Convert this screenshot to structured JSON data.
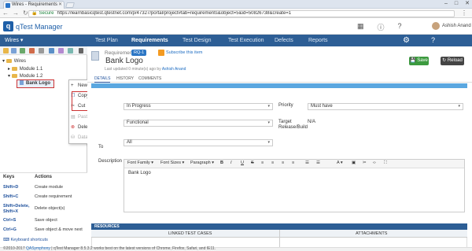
{
  "browser": {
    "tab_title": "Wires - Requirements",
    "url_secure_label": "Secure",
    "url_path": "https://learnbasicqtest.qtestnet.com/p/47327/portal/project#tab=requirements&object=5&id=50826738&create=1"
  },
  "app": {
    "logo_text": "qTest",
    "product": "Manager",
    "user_name": "Ashish Anand"
  },
  "nav": {
    "project": "Wires ▾",
    "items": [
      "Test Plan",
      "Requirements",
      "Test Design",
      "Test Execution",
      "Defects",
      "Reports"
    ],
    "active": "Requirements"
  },
  "tree": {
    "root": "Wires",
    "modules": [
      "Module 1.1",
      "Module 1.2"
    ],
    "selected": "Bank Logo"
  },
  "context_menu": {
    "items": [
      {
        "label": "New",
        "icon": "plus-icon",
        "enabled": true,
        "submenu": true
      },
      {
        "label": "Copy",
        "icon": "copy-icon",
        "enabled": true
      },
      {
        "label": "Cut",
        "icon": "cut-icon",
        "enabled": true
      },
      {
        "label": "Paste",
        "icon": "paste-icon",
        "enabled": false
      },
      {
        "label": "Delete",
        "icon": "delete-icon",
        "enabled": true
      },
      {
        "label": "Data Query",
        "icon": "data-query-icon",
        "enabled": false
      }
    ]
  },
  "keys": {
    "col_keys": "Keys",
    "col_actions": "Actions",
    "rows": [
      {
        "key": "Shift+D",
        "action": "Create module"
      },
      {
        "key": "Shift+C",
        "action": "Create requirement"
      },
      {
        "key": "Shift+Delete, Shift+X",
        "action": "Delete object(s)"
      },
      {
        "key": "Ctrl+S",
        "action": "Save object"
      },
      {
        "key": "Ctrl+G",
        "action": "Save object & move next"
      }
    ],
    "shortcuts_link": "Keyboard shortcuts"
  },
  "requirement": {
    "label": "Requirement",
    "id": "RQ-1",
    "subscribe": "Subscribe this item",
    "title": "Bank Logo",
    "last_updated_prefix": "Last updated 0 minute(s) ago by",
    "last_updated_user": "Ashish Anand",
    "save_label": "Save",
    "reload_label": "Reload",
    "tabs": [
      "DETAILS",
      "HISTORY",
      "COMMENTS"
    ],
    "fields": {
      "status_value": "In Progress",
      "priority_label": "Priority",
      "priority_value": "Must have",
      "type_value": "Functional",
      "target_label": "Target Release/Build",
      "target_value": "N/A",
      "assigned_label": "To",
      "assigned_value": "All",
      "description_label": "Description",
      "description_text": "Bank Logo"
    },
    "editor_tools": [
      "Font Family ▾",
      "Font Sizes ▾",
      "Paragraph ▾",
      "B",
      "I",
      "U",
      "S",
      "≡",
      "≡",
      "≡",
      "≡",
      "☰",
      "☰",
      "A ▾",
      "▣",
      "✂",
      "‹›",
      "⛶"
    ]
  },
  "resources": {
    "title": "RESOURCES",
    "col_linked": "LINKED TEST CASES",
    "col_attach": "ATTACHMENTS"
  },
  "footer": {
    "copyright": "2010-2017",
    "company": "QASymphony",
    "text": "qTest Manager 8.5.3.2 works best on the latest versions of Chrome, Firefox, Safari, and IE11."
  },
  "colors": {
    "nav_bg": "#2d5e95",
    "highlight_box": "#cc3333",
    "save_green": "#3c9a3f",
    "props_bar": "#5aa7e0"
  }
}
